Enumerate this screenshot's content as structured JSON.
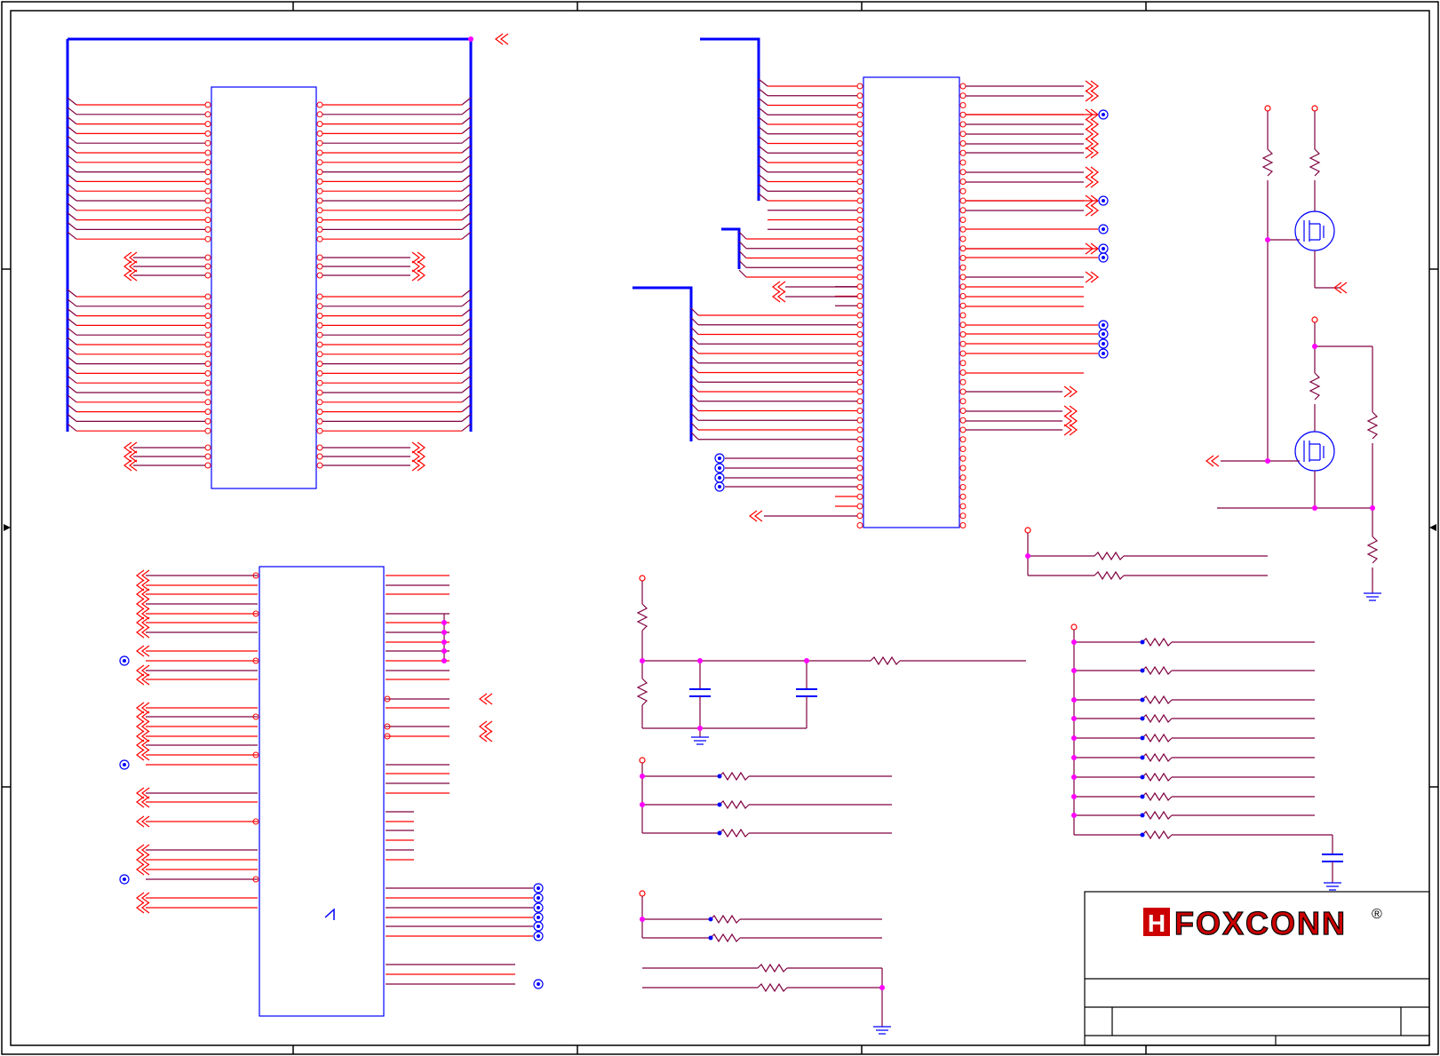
{
  "title_block": {
    "brand": "FOXCONN",
    "brand_mark": "H",
    "registered_symbol": "®"
  },
  "colors": {
    "net_wire": "#ff0000",
    "signal_wire": "#800040",
    "bus_wire": "#0000ff",
    "component_outline": "#0000ff",
    "junction": "#ff00ff",
    "border": "#000000",
    "logo_red": "#cc0000"
  }
}
